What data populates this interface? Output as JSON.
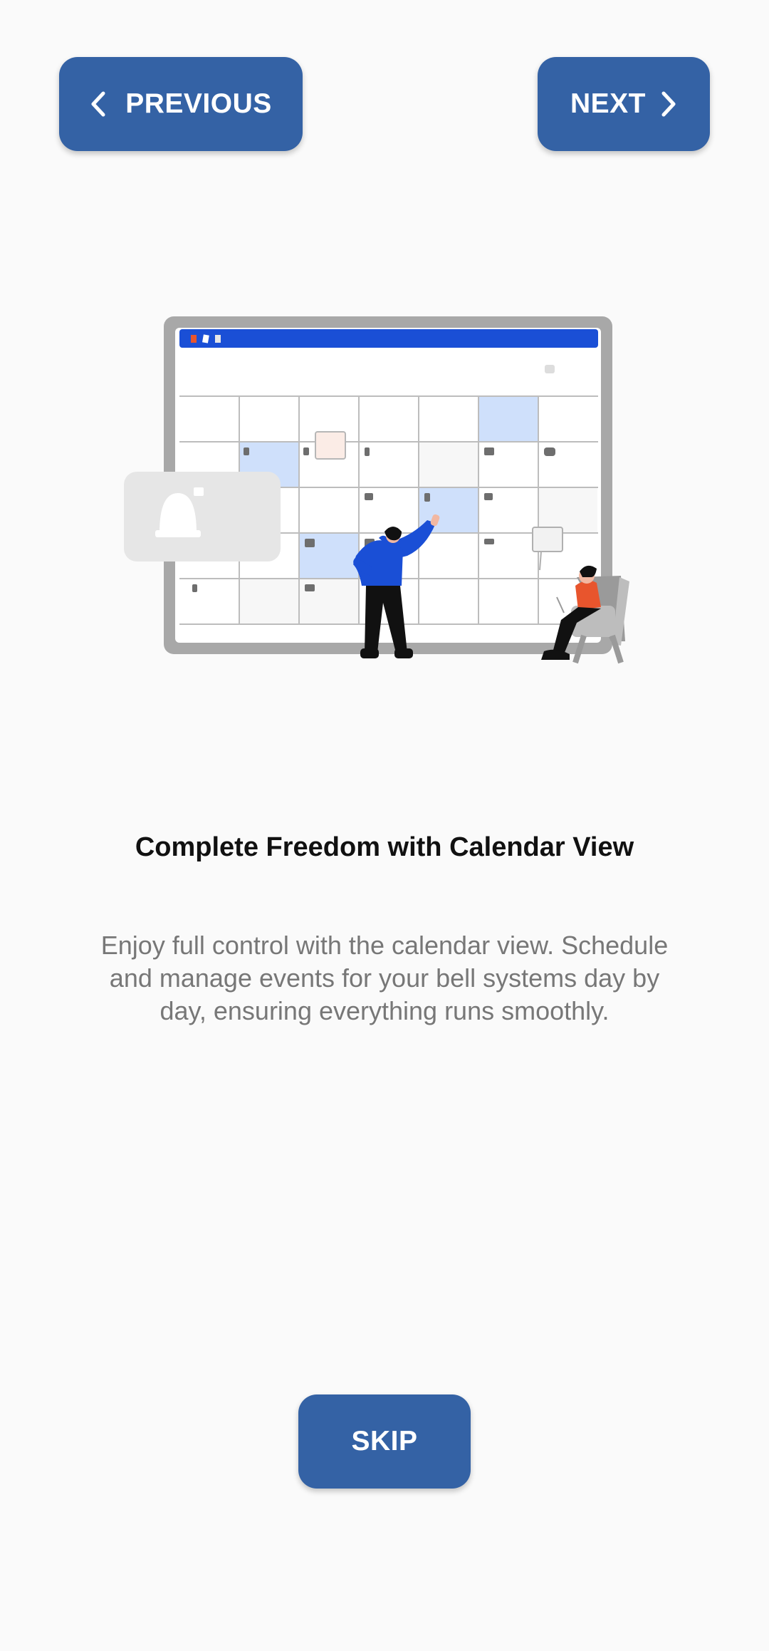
{
  "navigation": {
    "previous_label": "PREVIOUS",
    "next_label": "NEXT",
    "skip_label": "SKIP"
  },
  "onboarding": {
    "title": "Complete Freedom with Calendar View",
    "description": "Enjoy full control with the calendar view. Schedule and manage events for your bell systems day by day, ensuring everything runs smoothly."
  },
  "icons": {
    "previous": "chevron-left-icon",
    "next": "chevron-right-icon",
    "illustration": "calendar-illustration"
  },
  "colors": {
    "background": "#fafafa",
    "button": "#3462a5",
    "button_text": "#ffffff",
    "title": "#111111",
    "description": "#777777",
    "calendar_header": "#1a4fd6",
    "highlight_cell": "#cfe0fb"
  }
}
